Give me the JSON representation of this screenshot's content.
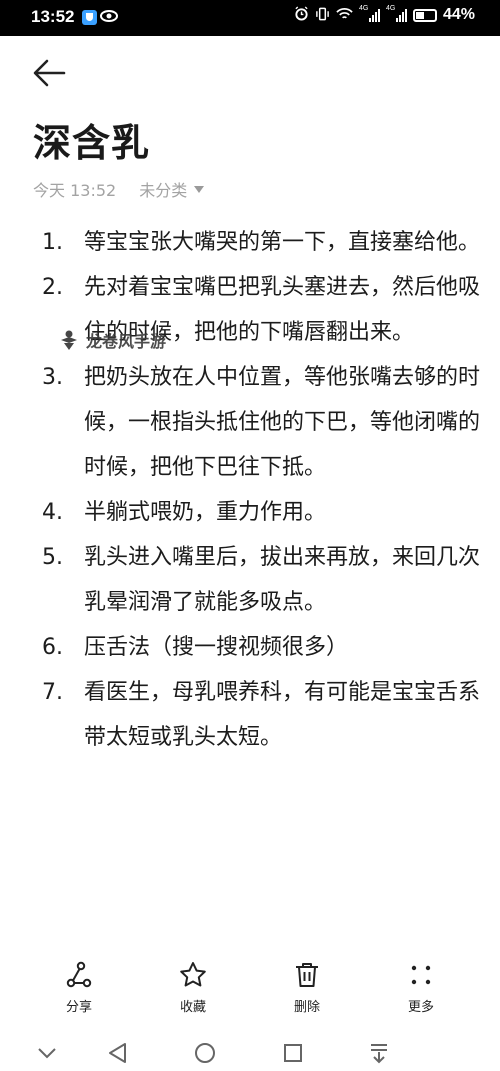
{
  "status_bar": {
    "time": "13:52",
    "net_tag_1": "4G",
    "net_tag_2": "4G",
    "battery": "44%"
  },
  "note": {
    "title": "深含乳",
    "date": "今天 13:52",
    "category": "未分类",
    "items": [
      {
        "num": "1.",
        "text": "等宝宝张大嘴哭的第一下，直接塞给他。"
      },
      {
        "num": "2.",
        "text": "先对着宝宝嘴巴把乳头塞进去，然后他吸住的时候，把他的下嘴唇翻出来。"
      },
      {
        "num": "3.",
        "text": "把奶头放在人中位置，等他张嘴去够的时候，一根指头抵住他的下巴，等他闭嘴的时候，把他下巴往下抵。"
      },
      {
        "num": "4.",
        "text": "半躺式喂奶，重力作用。"
      },
      {
        "num": "5.",
        "text": "乳头进入嘴里后，拔出来再放，来回几次乳晕润滑了就能多吸点。"
      },
      {
        "num": "6.",
        "text": "压舌法（搜一搜视频很多）"
      },
      {
        "num": "7.",
        "text": "看医生，母乳喂养科，有可能是宝宝舌系带太短或乳头太短。"
      }
    ]
  },
  "watermark": {
    "text": "龙卷风手游"
  },
  "actions": {
    "share": "分享",
    "favorite": "收藏",
    "delete": "删除",
    "more": "更多"
  },
  "colors": {
    "status_bar_bg": "#000000",
    "meta_text": "#a3a3a3",
    "body_text": "#1c1c1c"
  }
}
